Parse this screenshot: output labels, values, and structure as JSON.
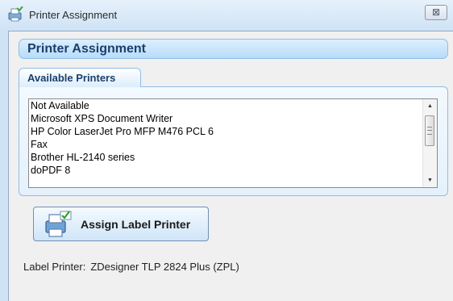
{
  "window": {
    "title": "Printer Assignment",
    "close_glyph": "⊠",
    "title_icon": "printer-icon"
  },
  "header": {
    "title": "Printer Assignment"
  },
  "printers_tab": {
    "label": "Available Printers"
  },
  "printers": {
    "items": [
      "Not Available",
      "Microsoft XPS Document Writer",
      "HP Color LaserJet Pro MFP M476 PCL 6",
      "Fax",
      "Brother HL-2140 series",
      "doPDF 8"
    ],
    "scroll_up": "▲",
    "scroll_down": "▼"
  },
  "assign_button": {
    "label": "Assign Label Printer",
    "icon": "printer-check-icon"
  },
  "label_printer": {
    "caption": "Label Printer:",
    "value": "ZDesigner TLP 2824 Plus (ZPL)"
  },
  "colors": {
    "window_frame": "#cfe3f5",
    "client_bg": "#f0f0f0",
    "header_text": "#1b3f6e",
    "accent_border": "#8fbde8"
  }
}
